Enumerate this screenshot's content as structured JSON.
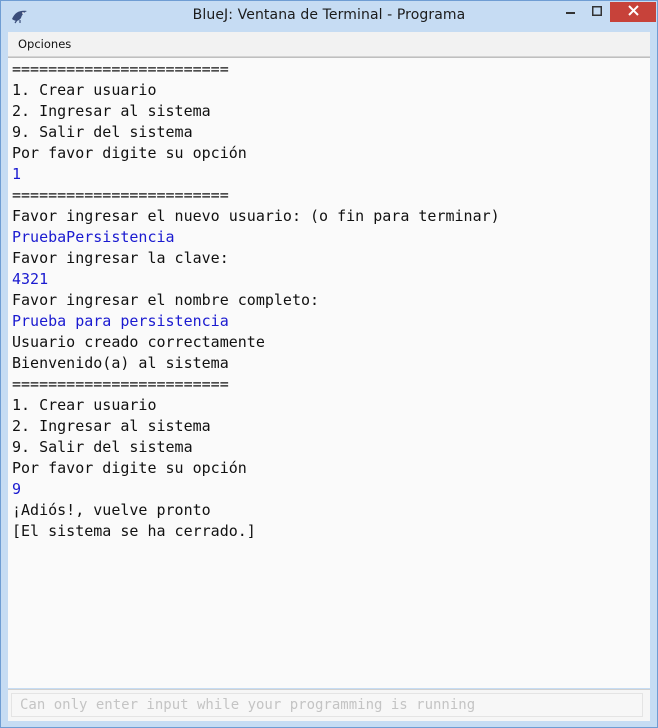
{
  "window": {
    "title": "BlueJ: Ventana de Terminal - Programa",
    "icons": {
      "app": "bluej-bird-icon",
      "minimize": "minimize-icon",
      "maximize": "maximize-icon",
      "close": "close-icon"
    },
    "colors": {
      "frame": "#c6dcf3",
      "close_button": "#c7423a",
      "user_input_text": "#1a1ad0",
      "program_text": "#111111"
    }
  },
  "menubar": {
    "items": [
      {
        "label": "Opciones"
      }
    ]
  },
  "terminal": {
    "lines": [
      {
        "text": "========================",
        "kind": "output"
      },
      {
        "text": "1. Crear usuario",
        "kind": "output"
      },
      {
        "text": "2. Ingresar al sistema",
        "kind": "output"
      },
      {
        "text": "9. Salir del sistema",
        "kind": "output"
      },
      {
        "text": "Por favor digite su opción",
        "kind": "output"
      },
      {
        "text": "1",
        "kind": "input"
      },
      {
        "text": "========================",
        "kind": "output"
      },
      {
        "text": "Favor ingresar el nuevo usuario: (o fin para terminar)",
        "kind": "output"
      },
      {
        "text": "PruebaPersistencia",
        "kind": "input"
      },
      {
        "text": "Favor ingresar la clave:",
        "kind": "output"
      },
      {
        "text": "4321",
        "kind": "input"
      },
      {
        "text": "Favor ingresar el nombre completo:",
        "kind": "output"
      },
      {
        "text": "Prueba para persistencia",
        "kind": "input"
      },
      {
        "text": "Usuario creado correctamente",
        "kind": "output"
      },
      {
        "text": "Bienvenido(a) al sistema",
        "kind": "output"
      },
      {
        "text": "========================",
        "kind": "output"
      },
      {
        "text": "1. Crear usuario",
        "kind": "output"
      },
      {
        "text": "2. Ingresar al sistema",
        "kind": "output"
      },
      {
        "text": "9. Salir del sistema",
        "kind": "output"
      },
      {
        "text": "Por favor digite su opción",
        "kind": "output"
      },
      {
        "text": "9",
        "kind": "input"
      },
      {
        "text": "¡Adiós!, vuelve pronto",
        "kind": "output"
      },
      {
        "text": "[El sistema se ha cerrado.]",
        "kind": "output"
      }
    ]
  },
  "input": {
    "value": "",
    "placeholder": "Can only enter input while your programming is running"
  }
}
